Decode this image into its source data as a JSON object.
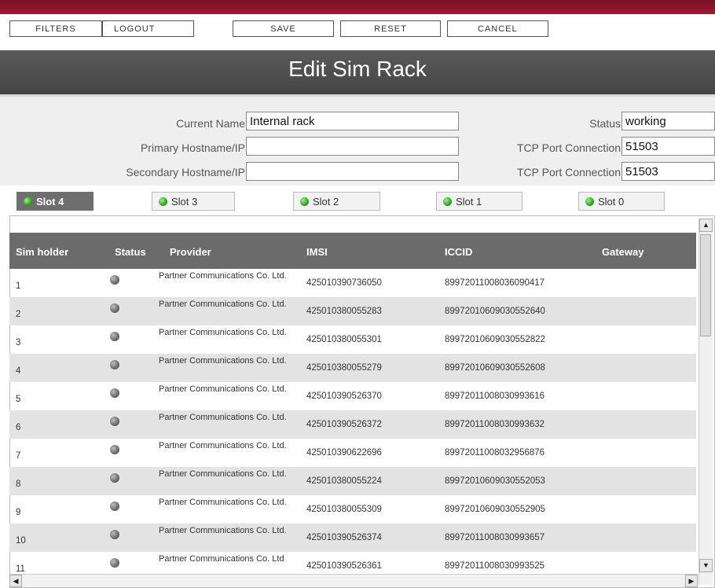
{
  "toolbar": {
    "filters": "FILTERS",
    "logout": "LOGOUT",
    "save": "SAVE",
    "reset": "RESET",
    "cancel": "CANCEL"
  },
  "title": "Edit Sim Rack",
  "form": {
    "current_name_label": "Current Name",
    "current_name_value": "Internal rack",
    "primary_host_label": "Primary Hostname/IP",
    "primary_host_value": "",
    "secondary_host_label": "Secondary Hostname/IP",
    "secondary_host_value": "",
    "status_label": "Status",
    "status_value": "working",
    "tcp_label_1": "TCP Port Connection",
    "tcp_value_1": "51503",
    "tcp_label_2": "TCP Port Connection",
    "tcp_value_2": "51503"
  },
  "tabs": [
    {
      "label": "Slot 4",
      "active": true
    },
    {
      "label": "Slot 3",
      "active": false
    },
    {
      "label": "Slot 2",
      "active": false
    },
    {
      "label": "Slot 1",
      "active": false
    },
    {
      "label": "Slot 0",
      "active": false
    }
  ],
  "table": {
    "headers": [
      "Sim holder",
      "Status",
      "Provider",
      "IMSI",
      "ICCID",
      "Gateway"
    ],
    "rows": [
      {
        "holder": "1",
        "provider": "Partner Communications Co. Ltd.",
        "imsi": "425010390736050",
        "iccid": "8997201100803609041​7"
      },
      {
        "holder": "2",
        "provider": "Partner Communications Co. Ltd.",
        "imsi": "425010380055283",
        "iccid": "8997201060903055264​0"
      },
      {
        "holder": "3",
        "provider": "Partner Communications Co. Ltd.",
        "imsi": "425010380055301",
        "iccid": "89972010609030552822"
      },
      {
        "holder": "4",
        "provider": "Partner Communications Co. Ltd.",
        "imsi": "425010380055279",
        "iccid": "89972010609030552608"
      },
      {
        "holder": "5",
        "provider": "Partner Communications Co. Ltd.",
        "imsi": "425010390526370",
        "iccid": "89972011008030993616"
      },
      {
        "holder": "6",
        "provider": "Partner Communications Co. Ltd.",
        "imsi": "425010390526372",
        "iccid": "89972011008030993632"
      },
      {
        "holder": "7",
        "provider": "Partner Communications Co. Ltd.",
        "imsi": "425010390622696",
        "iccid": "89972011008032956876"
      },
      {
        "holder": "8",
        "provider": "Partner Communications Co. Ltd.",
        "imsi": "425010380055224",
        "iccid": "89972010609030552053"
      },
      {
        "holder": "9",
        "provider": "Partner Communications Co. Ltd.",
        "imsi": "425010380055309",
        "iccid": "89972010609030552905"
      },
      {
        "holder": "10",
        "provider": "Partner Communications Co. Ltd.",
        "imsi": "425010390526374",
        "iccid": "89972011008030993657"
      },
      {
        "holder": "11",
        "provider": "Partner Communications Co. Ltd",
        "imsi": "425010390526361",
        "iccid": "89972011008030993525"
      }
    ]
  },
  "colors": {
    "brand_bar": "#8b1530",
    "title_bar": "#505050",
    "active_tab": "#6e6e6e",
    "header_row": "#6b6b6b",
    "status_dot_active": "#2fa21d",
    "status_dot_idle": "#6a6a6a"
  },
  "icons": {
    "slot_status": "green-dot-icon",
    "sim_status": "gray-dot-icon",
    "scroll_up": "arrow-up-icon",
    "scroll_down": "arrow-down-icon",
    "scroll_left": "arrow-left-icon",
    "scroll_right": "arrow-right-icon"
  }
}
